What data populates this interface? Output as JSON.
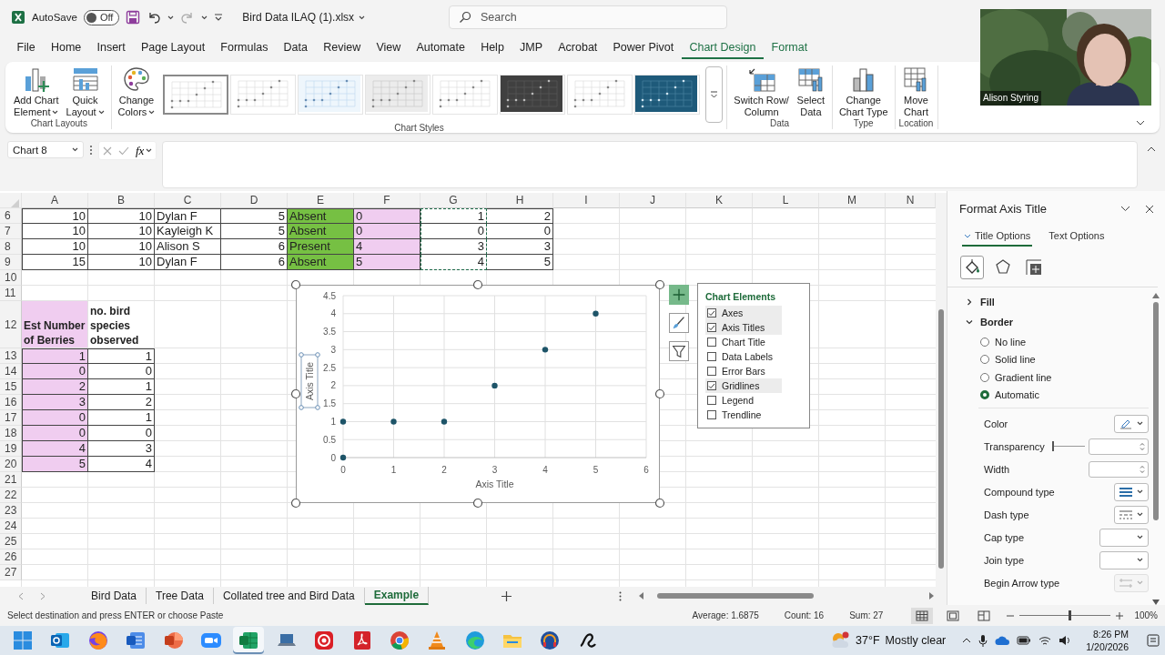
{
  "title_bar": {
    "autosave_label": "AutoSave",
    "autosave_toggle": {
      "label": "Off",
      "on": false
    },
    "file_name": "Bird Data ILAQ (1).xlsx",
    "search": {
      "placeholder": "Search"
    }
  },
  "webcam": {
    "caption": "Alison Styring"
  },
  "menu_tabs": [
    {
      "label": "File",
      "selected": false,
      "contextual": false
    },
    {
      "label": "Home",
      "selected": false,
      "contextual": false
    },
    {
      "label": "Insert",
      "selected": false,
      "contextual": false
    },
    {
      "label": "Page Layout",
      "selected": false,
      "contextual": false
    },
    {
      "label": "Formulas",
      "selected": false,
      "contextual": false
    },
    {
      "label": "Data",
      "selected": false,
      "contextual": false
    },
    {
      "label": "Review",
      "selected": false,
      "contextual": false
    },
    {
      "label": "View",
      "selected": false,
      "contextual": false
    },
    {
      "label": "Automate",
      "selected": false,
      "contextual": false
    },
    {
      "label": "Help",
      "selected": false,
      "contextual": false
    },
    {
      "label": "JMP",
      "selected": false,
      "contextual": false
    },
    {
      "label": "Acrobat",
      "selected": false,
      "contextual": false
    },
    {
      "label": "Power Pivot",
      "selected": false,
      "contextual": false
    },
    {
      "label": "Chart Design",
      "selected": true,
      "contextual": true
    },
    {
      "label": "Format",
      "selected": false,
      "contextual": true
    }
  ],
  "ribbon": [
    {
      "label": "Chart Layouts",
      "buttons": [
        {
          "lines": [
            "Add Chart",
            "Element"
          ],
          "kind": "add-element",
          "dropdown": true
        },
        {
          "lines": [
            "Quick",
            "Layout"
          ],
          "kind": "quick-layout",
          "dropdown": true
        }
      ]
    },
    {
      "label": "Chart Styles",
      "buttons": [
        {
          "lines": [
            "Change",
            "Colors"
          ],
          "kind": "colors",
          "dropdown": true
        }
      ],
      "gallery": [
        {
          "kind": "plain",
          "selected": true
        },
        {
          "kind": "plain",
          "selected": false
        },
        {
          "kind": "tinted",
          "selected": false
        },
        {
          "kind": "grey",
          "selected": false
        },
        {
          "kind": "plain",
          "selected": false
        },
        {
          "kind": "dark",
          "selected": false
        },
        {
          "kind": "plain",
          "selected": false
        },
        {
          "kind": "navy",
          "selected": false
        }
      ]
    },
    {
      "label": "Data",
      "buttons": [
        {
          "lines": [
            "Switch Row/",
            "Column"
          ],
          "kind": "switch",
          "dropdown": false
        },
        {
          "lines": [
            "Select",
            "Data"
          ],
          "kind": "select-data",
          "dropdown": false
        }
      ]
    },
    {
      "label": "Type",
      "buttons": [
        {
          "lines": [
            "Change",
            "Chart Type"
          ],
          "kind": "chart-type",
          "dropdown": false
        }
      ]
    },
    {
      "label": "Location",
      "buttons": [
        {
          "lines": [
            "Move",
            "Chart"
          ],
          "kind": "move",
          "dropdown": false
        }
      ]
    }
  ],
  "formula_bar": {
    "name_box": "Chart 8",
    "function_label": "fx"
  },
  "sheet": {
    "columns": [
      "A",
      "B",
      "C",
      "D",
      "E",
      "F",
      "G",
      "H",
      "I",
      "J",
      "K",
      "L",
      "M",
      "N"
    ],
    "rows": [
      {
        "number": "6",
        "bordered": true,
        "cells": [
          {
            "text": "10",
            "kind": "number",
            "copied": false
          },
          {
            "text": "10",
            "kind": "number",
            "copied": false
          },
          {
            "text": "Dylan F",
            "kind": "text",
            "copied": false
          },
          {
            "text": "5",
            "kind": "number",
            "copied": false
          },
          {
            "text": "Absent",
            "kind": "text",
            "color": "#76c043",
            "copied": false
          },
          {
            "text": "0",
            "kind": "text",
            "color": "#f0cdf0",
            "copied": false
          },
          {
            "text": "1",
            "kind": "number",
            "copied": true
          },
          {
            "text": "2",
            "kind": "number",
            "copied": false
          }
        ]
      },
      {
        "number": "7",
        "bordered": true,
        "cells": [
          {
            "text": "10",
            "kind": "number",
            "copied": false
          },
          {
            "text": "10",
            "kind": "number",
            "copied": false
          },
          {
            "text": "Kayleigh K",
            "kind": "text",
            "copied": false
          },
          {
            "text": "5",
            "kind": "number",
            "copied": false
          },
          {
            "text": "Absent",
            "kind": "text",
            "color": "#76c043",
            "copied": false
          },
          {
            "text": "0",
            "kind": "text",
            "color": "#f0cdf0",
            "copied": false
          },
          {
            "text": "0",
            "kind": "number",
            "copied": true
          },
          {
            "text": "0",
            "kind": "number",
            "copied": false
          }
        ]
      },
      {
        "number": "8",
        "bordered": true,
        "cells": [
          {
            "text": "10",
            "kind": "number",
            "copied": false
          },
          {
            "text": "10",
            "kind": "number",
            "copied": false
          },
          {
            "text": "Alison S",
            "kind": "text",
            "copied": false
          },
          {
            "text": "6",
            "kind": "number",
            "copied": false
          },
          {
            "text": "Present",
            "kind": "text",
            "color": "#76c043",
            "copied": false
          },
          {
            "text": "4",
            "kind": "text",
            "color": "#f0cdf0",
            "copied": false
          },
          {
            "text": "3",
            "kind": "number",
            "copied": true
          },
          {
            "text": "3",
            "kind": "number",
            "copied": false
          }
        ]
      },
      {
        "number": "9",
        "bordered": true,
        "cells": [
          {
            "text": "15",
            "kind": "number",
            "copied": false
          },
          {
            "text": "10",
            "kind": "number",
            "copied": false
          },
          {
            "text": "Dylan F",
            "kind": "text",
            "copied": false
          },
          {
            "text": "6",
            "kind": "number",
            "copied": false
          },
          {
            "text": "Absent",
            "kind": "text",
            "color": "#76c043",
            "copied": false
          },
          {
            "text": "5",
            "kind": "text",
            "color": "#f0cdf0",
            "copied": false
          },
          {
            "text": "4",
            "kind": "number",
            "copied": true
          },
          {
            "text": "5",
            "kind": "number",
            "copied": false
          }
        ]
      },
      {
        "number": "10"
      },
      {
        "number": "11"
      },
      {
        "number": "12",
        "bordered": false,
        "cells": [
          {
            "text": "Est Number of Berries",
            "kind": "header",
            "color": "#f0cdf0",
            "copied": false
          },
          {
            "text": "no. bird species observed",
            "kind": "header",
            "copied": false
          }
        ]
      },
      {
        "number": "13",
        "bordered": true,
        "cells": [
          {
            "text": "1",
            "kind": "number",
            "color": "#f0cdf0",
            "copied": false
          },
          {
            "text": "1",
            "kind": "number",
            "copied": false
          }
        ]
      },
      {
        "number": "14",
        "bordered": true,
        "cells": [
          {
            "text": "0",
            "kind": "number",
            "color": "#f0cdf0",
            "copied": false
          },
          {
            "text": "0",
            "kind": "number",
            "copied": false
          }
        ]
      },
      {
        "number": "15",
        "bordered": true,
        "cells": [
          {
            "text": "2",
            "kind": "number",
            "color": "#f0cdf0",
            "copied": false
          },
          {
            "text": "1",
            "kind": "number",
            "copied": false
          }
        ]
      },
      {
        "number": "16",
        "bordered": true,
        "cells": [
          {
            "text": "3",
            "kind": "number",
            "color": "#f0cdf0",
            "copied": false
          },
          {
            "text": "2",
            "kind": "number",
            "copied": false
          }
        ]
      },
      {
        "number": "17",
        "bordered": true,
        "cells": [
          {
            "text": "0",
            "kind": "number",
            "color": "#f0cdf0",
            "copied": false
          },
          {
            "text": "1",
            "kind": "number",
            "copied": false
          }
        ]
      },
      {
        "number": "18",
        "bordered": true,
        "cells": [
          {
            "text": "0",
            "kind": "number",
            "color": "#f0cdf0",
            "copied": false
          },
          {
            "text": "0",
            "kind": "number",
            "copied": false
          }
        ]
      },
      {
        "number": "19",
        "bordered": true,
        "cells": [
          {
            "text": "4",
            "kind": "number",
            "color": "#f0cdf0",
            "copied": false
          },
          {
            "text": "3",
            "kind": "number",
            "copied": false
          }
        ]
      },
      {
        "number": "20",
        "bordered": true,
        "cells": [
          {
            "text": "5",
            "kind": "number",
            "color": "#f0cdf0",
            "copied": false
          },
          {
            "text": "4",
            "kind": "number",
            "copied": false
          }
        ]
      },
      {
        "number": "21"
      },
      {
        "number": "22"
      },
      {
        "number": "23"
      },
      {
        "number": "24"
      },
      {
        "number": "25"
      },
      {
        "number": "26"
      },
      {
        "number": "27"
      }
    ]
  },
  "chart": {
    "selected": true,
    "ylabel_selected": true,
    "chart_data": {
      "type": "scatter",
      "grid": true,
      "xlabel": "Axis Title",
      "ylabel": "Axis Title",
      "x": [
        0,
        0,
        1,
        2,
        3,
        4,
        5
      ],
      "series": [
        {
          "color": "#1d5468",
          "values": [
            0,
            1,
            1,
            1,
            2,
            3,
            4
          ]
        }
      ],
      "xlim": [
        0,
        6
      ],
      "ylim": [
        0,
        4.5
      ],
      "xticks": [
        0,
        1,
        2,
        3,
        4,
        5,
        6
      ],
      "yticks": [
        0,
        0.5,
        1,
        1.5,
        2,
        2.5,
        3,
        3.5,
        4,
        4.5
      ]
    },
    "side_buttons": [
      {
        "kind": "elements",
        "selected": true
      },
      {
        "kind": "styles",
        "selected": false
      },
      {
        "kind": "filters",
        "selected": false
      }
    ],
    "elements_menu": {
      "title": "Chart Elements",
      "items": [
        {
          "label": "Axes",
          "checked": true
        },
        {
          "label": "Axis Titles",
          "checked": true
        },
        {
          "label": "Chart Title",
          "checked": false
        },
        {
          "label": "Data Labels",
          "checked": false
        },
        {
          "label": "Error Bars",
          "checked": false
        },
        {
          "label": "Gridlines",
          "checked": true
        },
        {
          "label": "Legend",
          "checked": false
        },
        {
          "label": "Trendline",
          "checked": false
        }
      ]
    }
  },
  "format_pane": {
    "title": "Format Axis Title",
    "tabs": [
      {
        "label": "Title Options",
        "selected": true
      },
      {
        "label": "Text Options",
        "selected": false
      }
    ],
    "icon_tabs": [
      {
        "kind": "fill",
        "selected": true
      },
      {
        "kind": "effects",
        "selected": false
      },
      {
        "kind": "size",
        "selected": false
      }
    ],
    "sections": [
      {
        "label": "Fill",
        "expanded": false
      },
      {
        "label": "Border",
        "expanded": true,
        "options": [
          {
            "label": "No line",
            "selected": false
          },
          {
            "label": "Solid line",
            "selected": false
          },
          {
            "label": "Gradient line",
            "selected": false
          },
          {
            "label": "Automatic",
            "selected": true
          }
        ],
        "properties": [
          {
            "label": "Color",
            "kind": "color",
            "disabled": false
          },
          {
            "label": "Transparency",
            "kind": "slider",
            "level": 0,
            "disabled": false
          },
          {
            "label": "Width",
            "kind": "spin",
            "disabled": false
          },
          {
            "label": "Compound type",
            "kind": "compound",
            "disabled": false
          },
          {
            "label": "Dash type",
            "kind": "dash",
            "disabled": false
          },
          {
            "label": "Cap type",
            "kind": "select",
            "disabled": false
          },
          {
            "label": "Join type",
            "kind": "select",
            "disabled": false
          },
          {
            "label": "Begin Arrow type",
            "kind": "arrow",
            "disabled": true
          }
        ]
      }
    ]
  },
  "sheet_tabs": [
    {
      "label": "Bird Data",
      "selected": false
    },
    {
      "label": "Tree Data",
      "selected": false
    },
    {
      "label": "Collated tree and Bird Data",
      "selected": false
    },
    {
      "label": "Example",
      "selected": true
    }
  ],
  "status_bar": {
    "message": "Select destination and press ENTER or choose Paste",
    "stats": [
      "Average: 1.6875",
      "Count: 16",
      "Sum: 27"
    ],
    "views": [
      {
        "kind": "normal",
        "selected": true
      },
      {
        "kind": "page-layout",
        "selected": false
      },
      {
        "kind": "page-break",
        "selected": false
      }
    ],
    "zoom": {
      "level": 0.55,
      "label": "100%"
    }
  },
  "taskbar": {
    "apps": [
      {
        "kind": "start",
        "active": false
      },
      {
        "kind": "mail",
        "active": false
      },
      {
        "kind": "browser-fox",
        "active": false
      },
      {
        "kind": "word",
        "active": false
      },
      {
        "kind": "slides",
        "active": false
      },
      {
        "kind": "video",
        "active": false
      },
      {
        "kind": "sheets",
        "active": true
      },
      {
        "kind": "laptop",
        "active": false
      },
      {
        "kind": "rings",
        "active": false
      },
      {
        "kind": "pdf",
        "active": false
      },
      {
        "kind": "browser-ring",
        "active": false
      },
      {
        "kind": "cone",
        "active": false
      },
      {
        "kind": "swirl",
        "active": false
      },
      {
        "kind": "folder",
        "active": false
      },
      {
        "kind": "headphones",
        "active": false
      },
      {
        "kind": "ink",
        "active": false
      }
    ],
    "weather": {
      "temperature": "37°F",
      "condition": "Mostly clear"
    },
    "time": "8:26 PM",
    "date": "1/20/2026"
  }
}
